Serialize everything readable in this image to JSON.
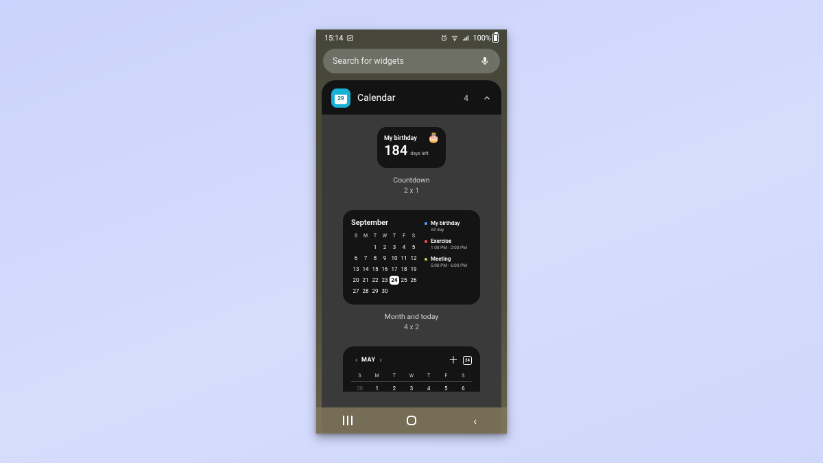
{
  "status": {
    "time": "15:14",
    "battery_pct": "100%"
  },
  "search": {
    "placeholder": "Search for widgets"
  },
  "category": {
    "icon_day": "29",
    "title": "Calendar",
    "count": "4"
  },
  "countdown_widget": {
    "title": "My birthday",
    "value": "184",
    "unit": "days left",
    "label": "Countdown",
    "size": "2 x 1"
  },
  "month_today_widget": {
    "month": "September",
    "dow": [
      "S",
      "M",
      "T",
      "W",
      "T",
      "F",
      "S"
    ],
    "weeks": [
      [
        "",
        "",
        "1",
        "2",
        "3",
        "4",
        "5"
      ],
      [
        "6",
        "7",
        "8",
        "9",
        "10",
        "11",
        "12"
      ],
      [
        "13",
        "14",
        "15",
        "16",
        "17",
        "18",
        "19"
      ],
      [
        "20",
        "21",
        "22",
        "23",
        "24",
        "25",
        "26"
      ],
      [
        "27",
        "28",
        "29",
        "30",
        "",
        "",
        ""
      ]
    ],
    "today": "24",
    "events": [
      {
        "dot": "#4da6ff",
        "title": "My birthday",
        "sub": "All day"
      },
      {
        "dot": "#ff4d4d",
        "title": "Exercise",
        "sub": "1:00 PM - 2:00 PM"
      },
      {
        "dot": "#c8d24a",
        "title": "Meeting",
        "sub": "5:00 PM - 6:00 PM"
      }
    ],
    "label": "Month and today",
    "size": "4 x 2"
  },
  "partial_widget": {
    "month": "MAY",
    "today_btn": "24",
    "dow": [
      "S",
      "M",
      "T",
      "W",
      "T",
      "F",
      "S"
    ],
    "row": [
      {
        "n": "30",
        "dim": true
      },
      {
        "n": "1"
      },
      {
        "n": "2"
      },
      {
        "n": "3"
      },
      {
        "n": "4"
      },
      {
        "n": "5"
      },
      {
        "n": "6"
      }
    ]
  }
}
